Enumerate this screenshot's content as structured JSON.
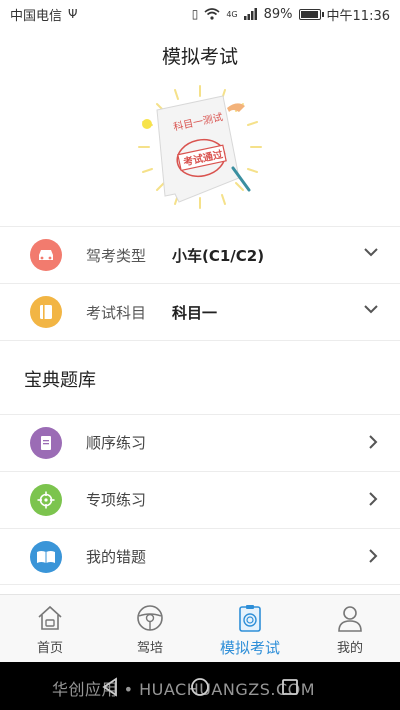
{
  "status_bar": {
    "carrier": "中国电信",
    "usb_symbol": "Ψ",
    "network_type": "4G",
    "battery_percent": "89%",
    "battery_level": 0.89,
    "time": "中午11:36"
  },
  "page_title": "模拟考试",
  "hero": {
    "paper_text": "科目一测试",
    "stamp_text": "考试通过"
  },
  "settings": [
    {
      "label": "驾考类型",
      "value": "小车(C1/C2)",
      "icon": "car-icon",
      "color": "#f27b6e"
    },
    {
      "label": "考试科目",
      "value": "科目一",
      "icon": "book-icon",
      "color": "#f2b544"
    }
  ],
  "section_title": "宝典题库",
  "practice_items": [
    {
      "label": "顺序练习",
      "icon": "document-icon",
      "color": "#9b6cb5"
    },
    {
      "label": "专项练习",
      "icon": "target-icon",
      "color": "#7cc44e"
    },
    {
      "label": "我的错题",
      "icon": "open-book-icon",
      "color": "#3a95d8"
    }
  ],
  "bottom_nav": [
    {
      "label": "首页",
      "icon": "home-icon"
    },
    {
      "label": "驾培",
      "icon": "steering-wheel-icon"
    },
    {
      "label": "模拟考试",
      "icon": "exam-badge-icon",
      "active": true
    },
    {
      "label": "我的",
      "icon": "user-icon"
    }
  ],
  "watermark": "华创应用 • HUACHUANGZS.COM",
  "colors": {
    "accent": "#2f8fd8",
    "stamp": "#d9534f"
  }
}
